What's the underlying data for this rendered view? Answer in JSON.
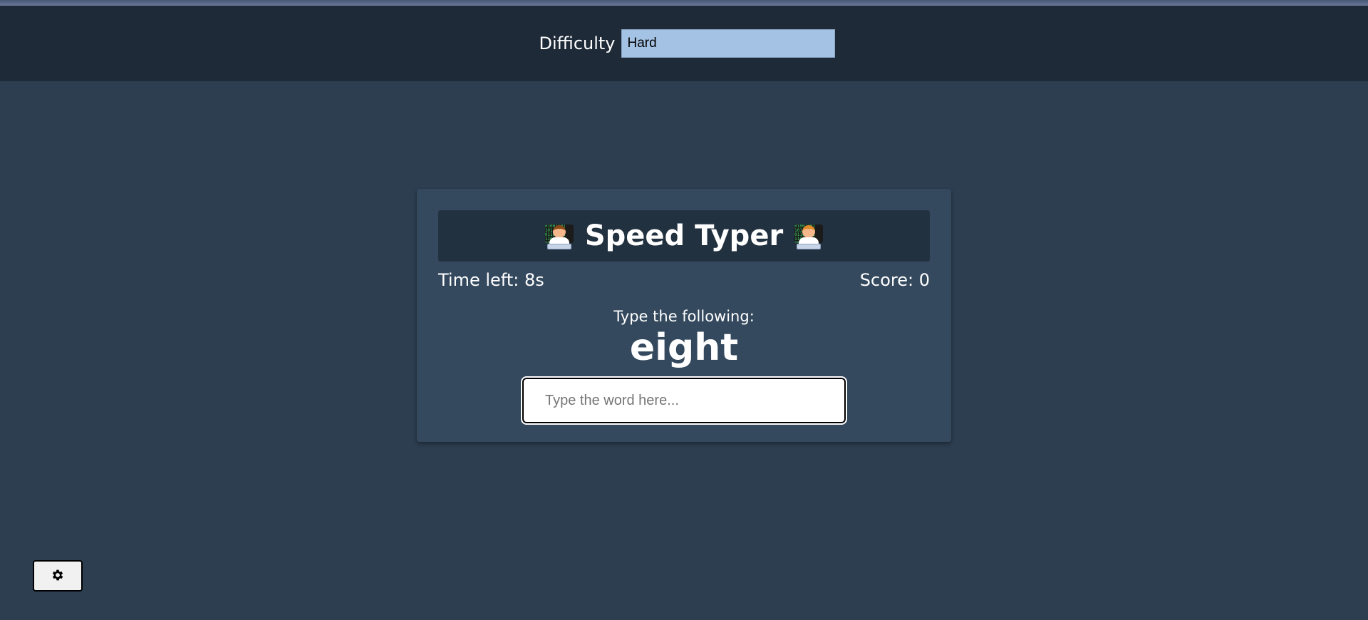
{
  "settings": {
    "difficulty_label": "Difficulty",
    "difficulty_value": "Hard"
  },
  "game": {
    "title": "Speed Typer",
    "title_icon": "technologist-emoji",
    "time_label": "Time left: 8s",
    "score_label": "Score: 0",
    "prompt_label": "Type the following:",
    "target_word": "eight",
    "input_placeholder": "Type the word here...",
    "input_value": ""
  },
  "toolbar": {
    "settings_icon": "gear-icon"
  },
  "colors": {
    "page_bg": "#2c3e50",
    "bar_bg": "#1f2a38",
    "card_bg": "#34495e",
    "title_bg": "#223140",
    "select_bg": "#a4c3e4"
  }
}
